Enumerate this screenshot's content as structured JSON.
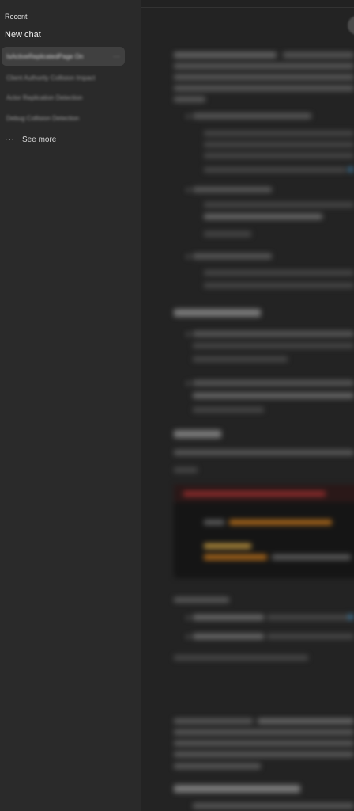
{
  "sidebar": {
    "recent_label": "Recent",
    "new_chat_label": "New chat",
    "history": [
      {
        "title": "IsActiveReplicatedPage On"
      },
      {
        "title": "Client Authority Collision Impact"
      },
      {
        "title": "Actor Replication Detection"
      },
      {
        "title": "Debug Collision Detection"
      }
    ],
    "more_glyph": "···",
    "see_more_label": "See more"
  },
  "colors": {
    "sidebar_bg": "#2a2a2a",
    "main_bg": "#232323",
    "active_item_bg": "#404040"
  },
  "icons": {
    "more_options": "ellipsis-icon",
    "see_more": "ellipsis-icon"
  }
}
